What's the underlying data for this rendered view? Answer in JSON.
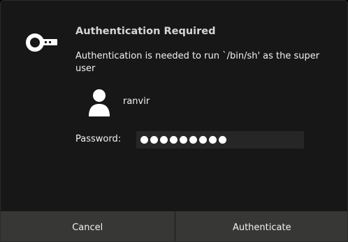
{
  "dialog": {
    "title": "Authentication Required",
    "message": "Authentication is needed to run `/bin/sh' as the super user",
    "username": "ranvir",
    "password_label": "Password:",
    "password_length": 9
  },
  "buttons": {
    "cancel_label": "Cancel",
    "authenticate_label": "Authenticate"
  },
  "icons": {
    "auth": "key-icon",
    "user": "user-avatar-icon"
  },
  "colors": {
    "background": "#171717",
    "button_bg": "#373735",
    "field_bg": "#262626",
    "text": "#f2f2f2"
  }
}
